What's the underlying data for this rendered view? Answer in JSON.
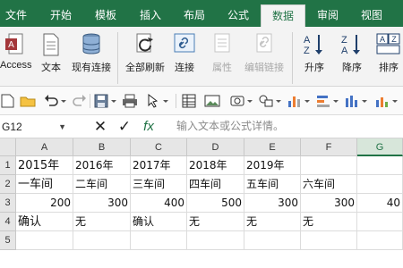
{
  "ribbon_tabs": [
    "文件",
    "开始",
    "模板",
    "插入",
    "布局",
    "公式",
    "数据",
    "审阅",
    "视图"
  ],
  "active_tab": "数据",
  "ribbon_buttons": {
    "access": "Access",
    "text": "文本",
    "existing": "现有连接",
    "refresh_all": "全部刷新",
    "connections": "连接",
    "properties": "属性",
    "edit_links": "编辑链接",
    "sort_asc": "升序",
    "sort_desc": "降序",
    "sort": "排序"
  },
  "formula_bar": {
    "name_box": "G12",
    "cancel_glyph": "✕",
    "enter_glyph": "✓",
    "fx": "fx",
    "placeholder": "输入文本或公式详情。"
  },
  "columns": [
    "A",
    "B",
    "C",
    "D",
    "E",
    "F",
    "G"
  ],
  "rows": [
    "1",
    "2",
    "3",
    "4",
    "5"
  ],
  "cells": {
    "row1": [
      "2015年",
      "2016年",
      "2017年",
      "2018年",
      "2019年",
      "",
      ""
    ],
    "row2": [
      "一车间",
      "二车间",
      "三车间",
      "四车间",
      "五车间",
      "六车间",
      ""
    ],
    "row3": [
      "200",
      "300",
      "400",
      "500",
      "300",
      "300",
      "40"
    ],
    "row4": [
      "确认",
      "无",
      "确认",
      "无",
      "无",
      "无",
      ""
    ],
    "row5": [
      "",
      "",
      "",
      "",
      "",
      "",
      ""
    ]
  },
  "colors": {
    "brand": "#217346",
    "ribbon_bg": "#f3f3f3"
  }
}
